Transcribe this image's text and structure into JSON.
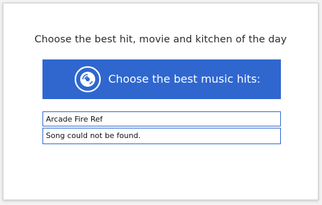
{
  "headline": "Choose the best hit, movie and kitchen of the day",
  "banner": {
    "label": "Choose the best music hits:",
    "icon": "music-disc-icon",
    "color": "#2f67cf"
  },
  "search": {
    "value": "Arcade Fire Ref"
  },
  "result": {
    "message": "Song could not be found."
  }
}
